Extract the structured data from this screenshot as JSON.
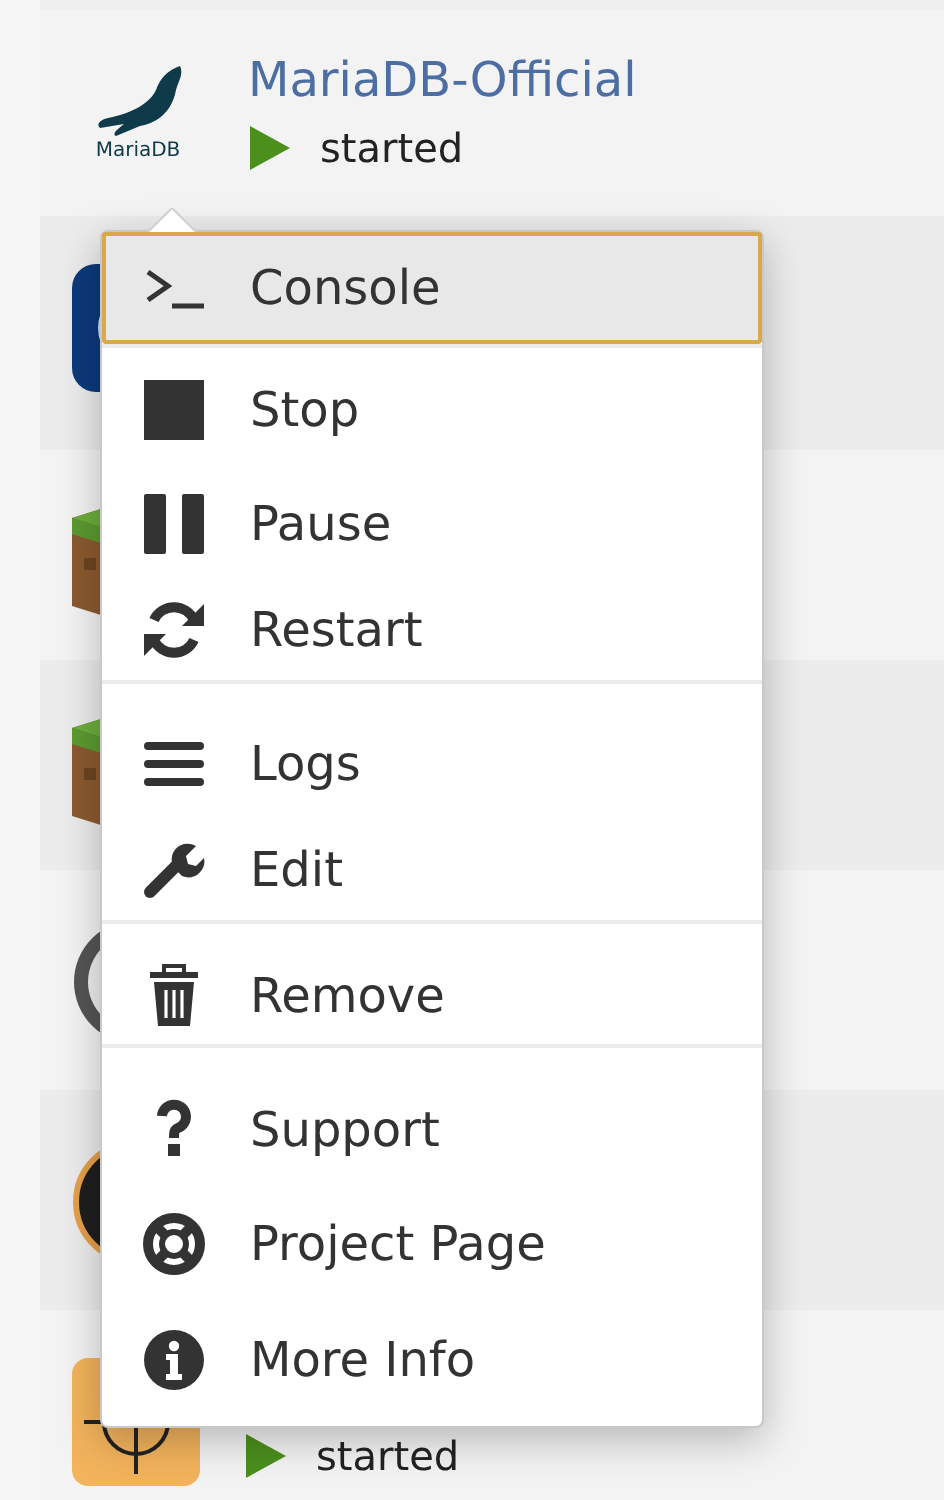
{
  "containers": [
    {
      "kind": "mariadb",
      "logo_text": "MariaDB",
      "name": "MariaDB-Official",
      "status": "started"
    },
    {
      "kind": "blue"
    },
    {
      "kind": "grass"
    },
    {
      "kind": "grass"
    },
    {
      "kind": "badge"
    },
    {
      "kind": "dark"
    },
    {
      "kind": "orange",
      "status": "started"
    }
  ],
  "context_menu": {
    "groups": [
      {
        "items": [
          {
            "kind": "console",
            "label": "Console",
            "selected": true
          }
        ]
      },
      {
        "items": [
          {
            "kind": "stop",
            "label": "Stop",
            "selected": false
          },
          {
            "kind": "pause",
            "label": "Pause",
            "selected": false
          },
          {
            "kind": "restart",
            "label": "Restart",
            "selected": false
          }
        ]
      },
      {
        "items": [
          {
            "kind": "logs",
            "label": "Logs",
            "selected": false
          },
          {
            "kind": "edit",
            "label": "Edit",
            "selected": false
          }
        ]
      },
      {
        "items": [
          {
            "kind": "remove",
            "label": "Remove",
            "selected": false
          }
        ]
      },
      {
        "items": [
          {
            "kind": "support",
            "label": "Support",
            "selected": false
          },
          {
            "kind": "project",
            "label": "Project Page",
            "selected": false
          },
          {
            "kind": "info",
            "label": "More Info",
            "selected": false
          }
        ]
      }
    ]
  }
}
